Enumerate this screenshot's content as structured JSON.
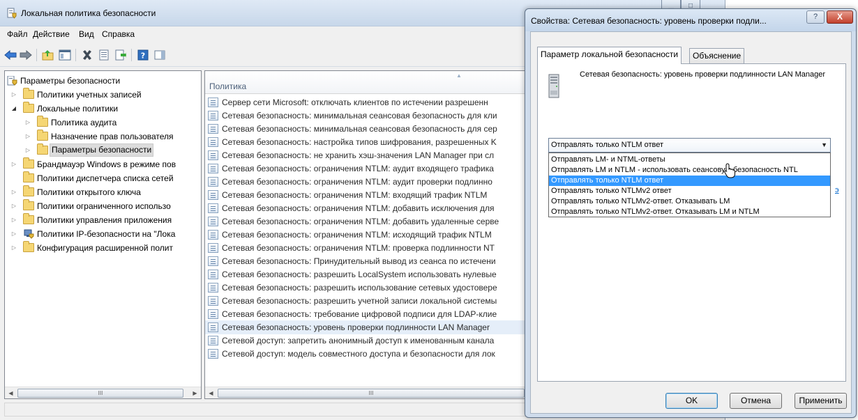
{
  "main_window": {
    "title": "Локальная политика безопасности",
    "menu": [
      "Файл",
      "Действие",
      "Вид",
      "Справка"
    ]
  },
  "tree": {
    "items": [
      {
        "label": "Параметры безопасности",
        "level": 0,
        "icon": "policy-root-icon"
      },
      {
        "label": "Политики учетных записей",
        "level": 1,
        "icon": "folder-icon"
      },
      {
        "label": "Локальные политики",
        "level": 1,
        "icon": "folder-icon"
      },
      {
        "label": "Политика аудита",
        "level": 2,
        "icon": "folder-icon"
      },
      {
        "label": "Назначение прав пользователя",
        "level": 2,
        "icon": "folder-icon"
      },
      {
        "label": "Параметры безопасности",
        "level": 2,
        "icon": "folder-icon",
        "selected": true
      },
      {
        "label": "Брандмауэр Windows в режиме пов",
        "level": 1,
        "icon": "folder-icon"
      },
      {
        "label": "Политики диспетчера списка сетей",
        "level": 1,
        "icon": "folder-icon"
      },
      {
        "label": "Политики открытого ключа",
        "level": 1,
        "icon": "folder-icon"
      },
      {
        "label": "Политики ограниченного использо",
        "level": 1,
        "icon": "folder-icon"
      },
      {
        "label": "Политики управления приложения",
        "level": 1,
        "icon": "folder-icon"
      },
      {
        "label": "Политики IP-безопасности на \"Лока",
        "level": 1,
        "icon": "ipsec-icon"
      },
      {
        "label": "Конфигурация расширенной полит",
        "level": 1,
        "icon": "folder-icon"
      }
    ]
  },
  "list": {
    "column_header": "Политика",
    "rows": [
      "Сервер сети Microsoft: отключать клиентов по истечении разрешенн",
      "Сетевая безопасность: минимальная сеансовая безопасность для кли",
      "Сетевая безопасность: минимальная сеансовая безопасность для сер",
      "Сетевая безопасность: настройка типов шифрования, разрешенных K",
      "Сетевая безопасность: не хранить хэш-значения LAN Manager при сл",
      "Сетевая безопасность: ограничения NTLM: аудит входящего трафика",
      "Сетевая безопасность: ограничения NTLM: аудит проверки подлинно",
      "Сетевая безопасность: ограничения NTLM: входящий трафик NTLM",
      "Сетевая безопасность: ограничения NTLM: добавить исключения для",
      "Сетевая безопасность: ограничения NTLM: добавить удаленные серве",
      "Сетевая безопасность: ограничения NTLM: исходящий трафик NTLM",
      "Сетевая безопасность: ограничения NTLM: проверка подлинности NT",
      "Сетевая безопасность: Принудительный вывод из сеанса по истечени",
      "Сетевая безопасность: разрешить LocalSystem использовать нулевые",
      "Сетевая безопасность: разрешить использование сетевых удостовере",
      "Сетевая безопасность: разрешить учетной записи локальной системы",
      "Сетевая безопасность: требование цифровой подписи для LDAP-клие",
      "Сетевая безопасность: уровень проверки подлинности LAN Manager",
      "Сетевой доступ: запретить анонимный доступ к именованным канала",
      "Сетевой доступ: модель совместного доступа и безопасности для лок"
    ],
    "selected_index": 17,
    "scroll_thumb": "III"
  },
  "tree_scroll_thumb": "III",
  "dialog": {
    "title": "Свойства: Сетевая безопасность: уровень проверки подли...",
    "help_glyph": "?",
    "close_glyph": "X",
    "tabs": [
      "Параметр локальной безопасности",
      "Объяснение"
    ],
    "policy_name": "Сетевая безопасность: уровень проверки подлинности LAN Manager",
    "select_value": "Отправлять только NTLM ответ",
    "options": [
      "Отправлять LM- и NTML-ответы",
      "Отправлять LM и NTLM - использовать сеансовую безопасность NTL",
      "Отправлять только NTLM ответ",
      "Отправлять только NTLMv2 ответ",
      "Отправлять только NTLMv2-ответ. Отказывать LM",
      "Отправлять только NTLMv2-ответ. Отказывать LM и NTLM"
    ],
    "selected_option_index": 2,
    "link_fragment": "э",
    "buttons": {
      "ok": "OK",
      "cancel": "Отмена",
      "apply": "Применить"
    }
  },
  "colors": {
    "selection_blue": "#3399ff",
    "close_red": "#c2402b",
    "titlebar": "#c7d7ea"
  }
}
